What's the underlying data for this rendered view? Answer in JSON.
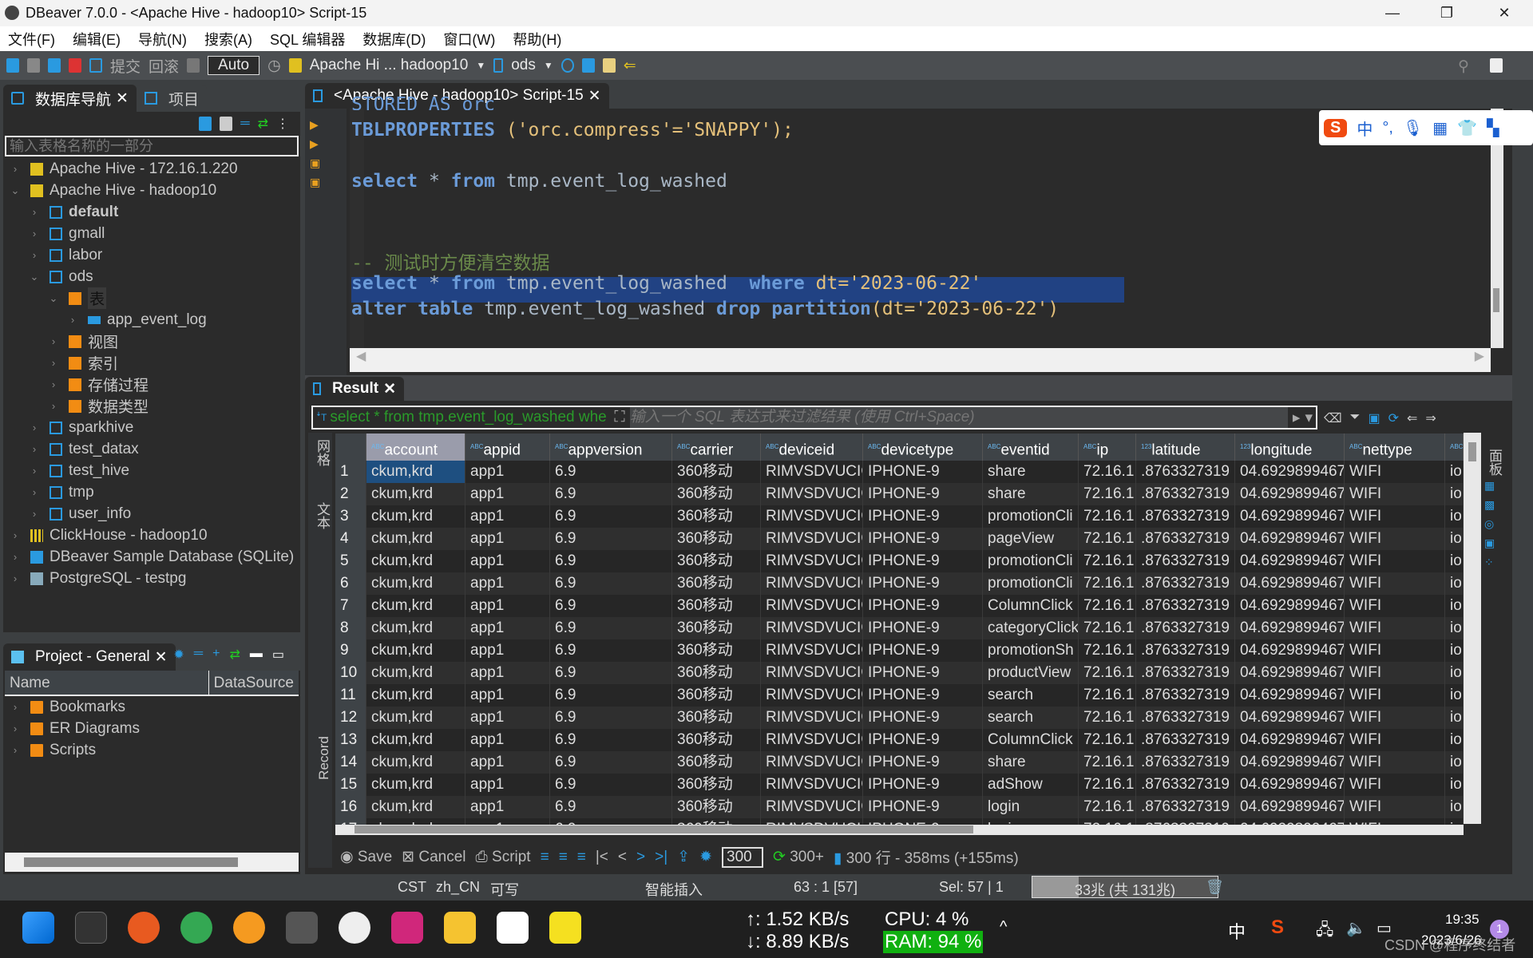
{
  "window": {
    "title": "DBeaver 7.0.0 - <Apache Hive - hadoop10> Script-15"
  },
  "menu": [
    "文件(F)",
    "编辑(E)",
    "导航(N)",
    "搜索(A)",
    "SQL 编辑器",
    "数据库(D)",
    "窗口(W)",
    "帮助(H)"
  ],
  "toolbar": {
    "commit": "提交",
    "rollback": "回滚",
    "mode": "Auto",
    "connection": "Apache Hi ... hadoop10",
    "schema": "ods"
  },
  "navigator": {
    "tab": "数据库导航",
    "tab2": "项目",
    "filter_placeholder": "输入表格名称的一部分",
    "items": [
      {
        "label": "Apache Hive - 172.16.1.220",
        "level": 0,
        "icon": "hive-icon"
      },
      {
        "label": "Apache Hive - hadoop10",
        "level": 0,
        "icon": "hive-connected-icon",
        "open": true
      },
      {
        "label": "default",
        "level": 1,
        "icon": "database-icon",
        "bold": true
      },
      {
        "label": "gmall",
        "level": 1,
        "icon": "database-icon"
      },
      {
        "label": "labor",
        "level": 1,
        "icon": "database-icon"
      },
      {
        "label": "ods",
        "level": 1,
        "icon": "database-icon",
        "open": true
      },
      {
        "label": "表",
        "level": 2,
        "icon": "tables-folder-icon",
        "open": true
      },
      {
        "label": "app_event_log",
        "level": 3,
        "icon": "table-icon"
      },
      {
        "label": "视图",
        "level": 2,
        "icon": "views-folder-icon"
      },
      {
        "label": "索引",
        "level": 2,
        "icon": "folder-icon"
      },
      {
        "label": "存储过程",
        "level": 2,
        "icon": "folder-icon"
      },
      {
        "label": "数据类型",
        "level": 2,
        "icon": "folder-icon"
      },
      {
        "label": "sparkhive",
        "level": 1,
        "icon": "database-icon"
      },
      {
        "label": "test_datax",
        "level": 1,
        "icon": "database-icon"
      },
      {
        "label": "test_hive",
        "level": 1,
        "icon": "database-icon"
      },
      {
        "label": "tmp",
        "level": 1,
        "icon": "database-icon"
      },
      {
        "label": "user_info",
        "level": 1,
        "icon": "database-icon"
      },
      {
        "label": "ClickHouse - hadoop10",
        "level": 0,
        "icon": "clickhouse-icon"
      },
      {
        "label": "DBeaver Sample Database (SQLite)",
        "level": 0,
        "icon": "sqlite-icon"
      },
      {
        "label": "PostgreSQL - testpg",
        "level": 0,
        "icon": "postgres-icon"
      }
    ]
  },
  "project": {
    "tab": "Project - General",
    "col_name": "Name",
    "col_ds": "DataSource",
    "items": [
      "Bookmarks",
      "ER Diagrams",
      "Scripts"
    ]
  },
  "editor": {
    "tab": "<Apache Hive - hadoop10> Script-15",
    "lines": {
      "l0": "STORED AS orc",
      "l1a": "TBLPROPERTIES",
      "l1b": " ('orc.compress'='SNAPPY');",
      "l2a": "select",
      "l2b": " * ",
      "l2c": "from",
      "l2d": " tmp.event_log_washed",
      "l3": "-- 测试时方便清空数据",
      "l4a": "select",
      "l4b": " * ",
      "l4c": "from",
      "l4d": " tmp.event_log_washed  ",
      "l4e": "where",
      "l4f": " dt='2023-06-22'",
      "l5a": "alter",
      "l5b": " ",
      "l5c": "table",
      "l5d": " tmp.event_log_washed ",
      "l5e": "drop",
      "l5f": " ",
      "l5g": "partition",
      "l5h": "(dt='2023-06-22')"
    }
  },
  "result": {
    "tab": "Result",
    "query": "select * from tmp.event_log_washed whe",
    "filter_placeholder": "输入一个 SQL 表达式来过滤结果 (使用 Ctrl+Space)",
    "side_left": [
      "网格",
      "文本"
    ],
    "side_record": "Record",
    "side_right": "面板",
    "columns": [
      "account",
      "appid",
      "appversion",
      "carrier",
      "deviceid",
      "devicetype",
      "eventid",
      "ip",
      "latitude",
      "longitude",
      "nettype",
      ""
    ],
    "column_types": [
      "ABC",
      "ABC",
      "ABC",
      "ABC",
      "ABC",
      "ABC",
      "ABC",
      "ABC",
      "123",
      "123",
      "ABC",
      "ABC"
    ],
    "eventids": [
      "share",
      "share",
      "promotionCli",
      "pageView",
      "promotionCli",
      "promotionCli",
      "ColumnClick",
      "categoryClick",
      "promotionSh",
      "productView",
      "search",
      "search",
      "ColumnClick",
      "share",
      "adShow",
      "login",
      "login"
    ],
    "common": {
      "account": "ckum,krd",
      "appid": "app1",
      "appversion": "6.9",
      "carrier": "360移动",
      "deviceid": "RIMVSDVUCIC",
      "devicetype": "IPHONE-9",
      "ip": "72.16.1",
      "latitude": ".8763327319",
      "longitude": "04.6929899467",
      "nettype": "WIFI",
      "next": "io"
    }
  },
  "bottom": {
    "save": "Save",
    "cancel": "Cancel",
    "script": "Script",
    "fetch": "300",
    "fetch_more": "300+",
    "summary": "300 行 - 358ms (+155ms)"
  },
  "statusbar": {
    "tz": "CST",
    "locale": "zh_CN",
    "mode": "可写",
    "insert": "智能插入",
    "pos": "63 : 1 [57]",
    "sel": "Sel: 57 | 1",
    "memory": "33兆 (共 131兆)",
    "memory_used_fraction": 0.25
  },
  "taskbar": {
    "up": "↑: 1.52 KB/s",
    "down": "↓: 8.89 KB/s",
    "cpu": "CPU: 4 %",
    "ram": "RAM: 94 %",
    "time": "19:35",
    "date": "2023/6/26",
    "lang": "中",
    "badge": "1",
    "watermark": "CSDN @程序终结者"
  },
  "colors": {
    "keyword": "#6b9bd8",
    "string": "#e4c07a",
    "comment": "#6a8a4a",
    "selection": "#214283",
    "accent": "#2a9ae0"
  }
}
